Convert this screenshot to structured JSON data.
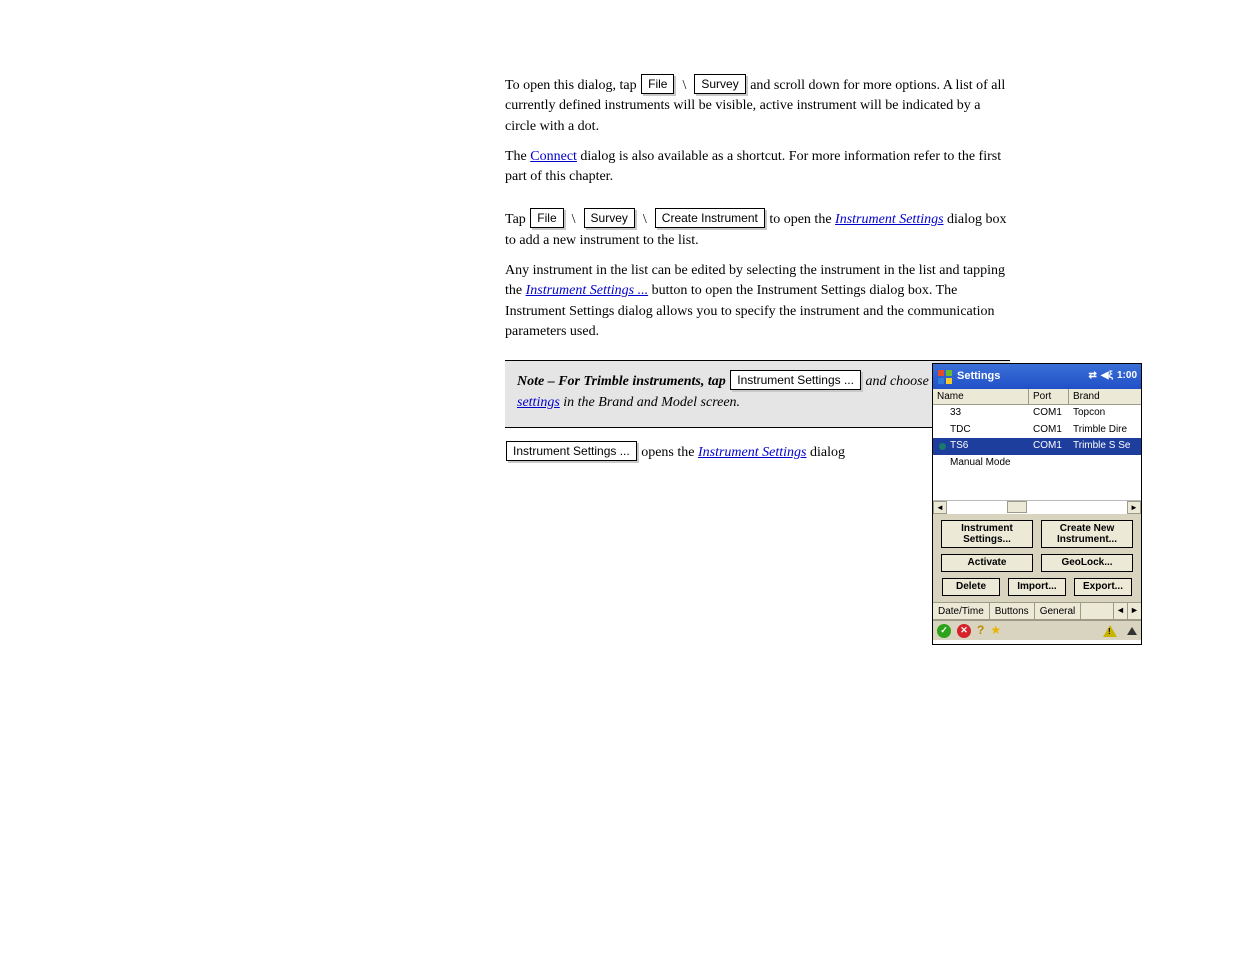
{
  "doc": {
    "p1a": "To open this dialog, tap ",
    "btn_file": "File",
    "btn_survey": "Survey",
    "p1b": " and scroll down for more options. A list of all currently defined instruments will be visible, active instrument will be indicated by a circle with a dot.",
    "p2a": "The ",
    "link_comm": "Connect",
    "p2b": " dialog is also available as a shortcut. For more information refer to the first part of this chapter.",
    "p3a": "Tap ",
    "btn_file2": "File",
    "btn_survey2": "Survey",
    "btn_create_inst": "Create Instrument",
    "p3b": " to open the ",
    "link_instset": "Instrument Settings",
    "p3c": " dialog box to add a new instrument to the list.",
    "p4a": "Any instrument in the list can be edited by selecting the instrument in the list and tapping the ",
    "link_instset2": "Instrument Settings ...",
    "p4b": " button to open the Instrument Settings dialog box. The Instrument Settings dialog allows you to specify the instrument and the communication parameters used.",
    "note_a": "Note – For Trimble instruments, tap ",
    "note_btn": "Instrument Settings ...",
    "note_b": " and choose ",
    "note_link": "Trimble settings",
    "note_c": " in the Brand and Model screen.",
    "p5_btn": "Instrument Settings ...",
    "p5a": " opens the ",
    "p5_link": "Instrument Settings",
    "p5b": " dialog"
  },
  "pda": {
    "title": "Settings",
    "time": "1:00",
    "cols": {
      "name": "Name",
      "port": "Port",
      "brand": "Brand"
    },
    "rows": [
      {
        "name": "33",
        "port": "COM1",
        "brand": "Topcon",
        "active": false,
        "sel": false
      },
      {
        "name": "TDC",
        "port": "COM1",
        "brand": "Trimble Dire",
        "active": false,
        "sel": false
      },
      {
        "name": "TS6",
        "port": "COM1",
        "brand": "Trimble S Se",
        "active": true,
        "sel": true
      },
      {
        "name": "Manual Mode",
        "port": "",
        "brand": "",
        "active": false,
        "sel": false
      }
    ],
    "buttons": {
      "instset": "Instrument Settings...",
      "createnew": "Create New Instrument...",
      "activate": "Activate",
      "geolock": "GeoLock...",
      "delete": "Delete",
      "import": "Import...",
      "export": "Export..."
    },
    "tabs": {
      "datetime": "Date/Time",
      "buttons": "Buttons",
      "general": "General"
    }
  }
}
